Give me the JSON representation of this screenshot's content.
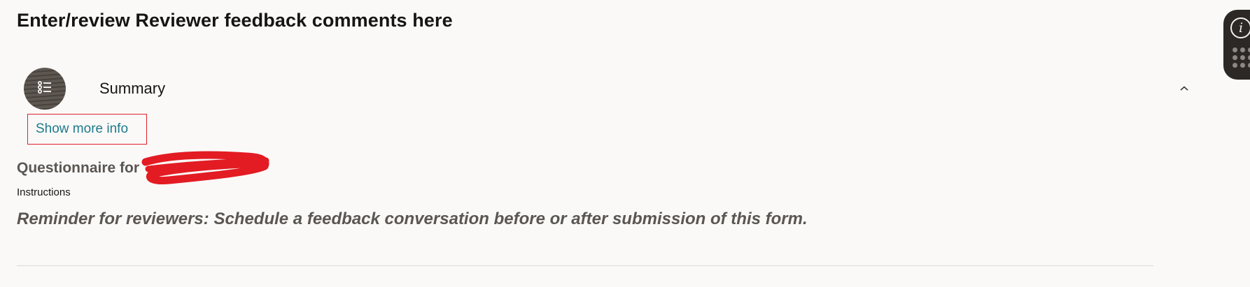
{
  "page": {
    "title": "Enter/review Reviewer feedback comments here"
  },
  "summary": {
    "label": "Summary",
    "avatar_icon": "list-icon",
    "toggle_icon": "chevron-up-icon",
    "show_more_label": "Show more info"
  },
  "questionnaire": {
    "title": "Questionnaire for",
    "instructions_label": "Instructions",
    "reminder": "Reminder for reviewers: Schedule a feedback conversation before or after submission of this form."
  },
  "side_panel": {
    "info_glyph": "i",
    "info_icon": "info-icon",
    "apps_icon": "apps-grid-icon"
  },
  "colors": {
    "background": "#faf9f8",
    "link": "#1f7a8a",
    "highlight_border": "#e0202a",
    "redaction": "#e31b23",
    "muted_heading": "#5b5652",
    "panel": "#2b2825"
  }
}
